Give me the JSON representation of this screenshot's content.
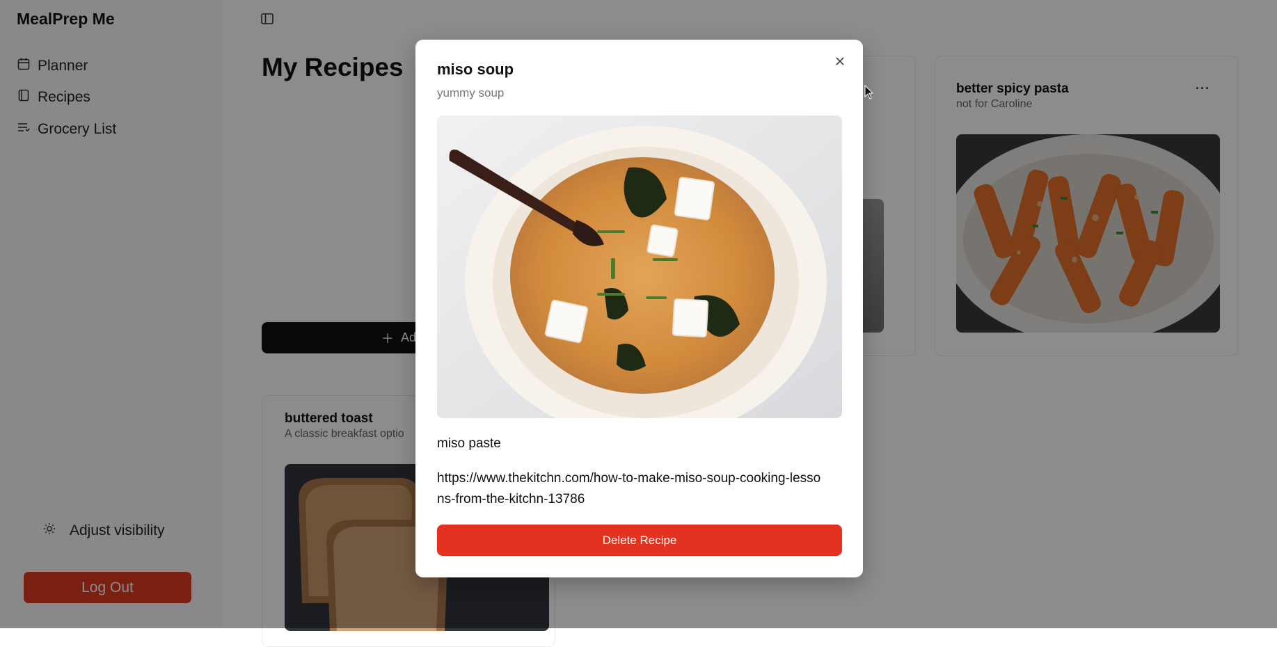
{
  "app": {
    "title": "MealPrep Me"
  },
  "sidebar": {
    "items": [
      {
        "label": "Planner",
        "icon": "calendar-icon"
      },
      {
        "label": "Recipes",
        "icon": "book-icon"
      },
      {
        "label": "Grocery List",
        "icon": "list-icon"
      }
    ],
    "adjust_visibility": {
      "label": "Adjust visibility",
      "icon": "sun-icon"
    },
    "logout_label": "Log Out"
  },
  "main": {
    "title": "My Recipes",
    "add_button_label": "Ad",
    "cards": [
      {
        "title": "better spicy pasta",
        "description": "not for Caroline",
        "menu": "···"
      },
      {
        "title": "buttered toast",
        "description": "A classic breakfast optio"
      }
    ]
  },
  "modal": {
    "title": "miso soup",
    "description": "yummy soup",
    "ingredients": "miso paste",
    "link": "https://www.thekitchn.com/how-to-make-miso-soup-cooking-lessons-from-the-kitchn-13786",
    "delete_label": "Delete Recipe",
    "close_icon": "close-icon"
  },
  "colors": {
    "accent_red": "#e3321f",
    "dark_button": "#111111"
  }
}
